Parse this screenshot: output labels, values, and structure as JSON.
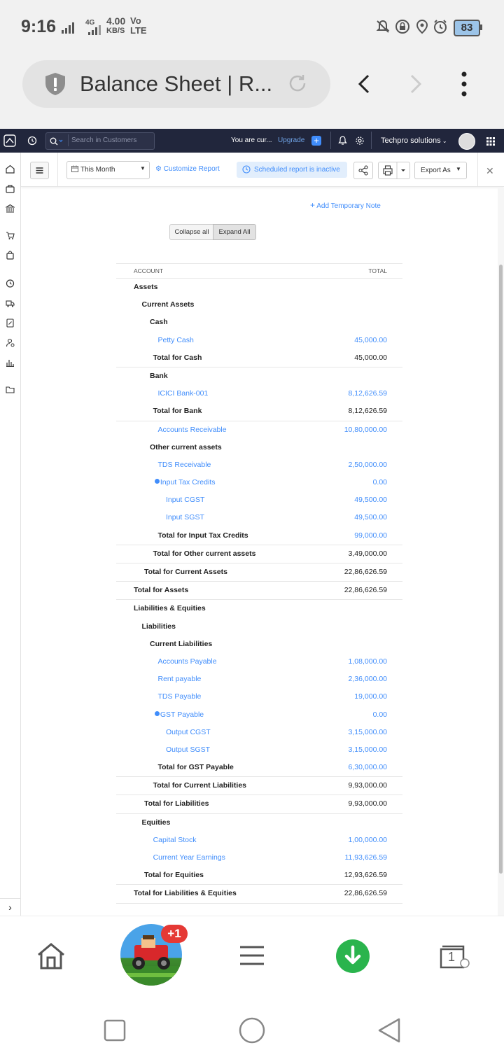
{
  "status_bar": {
    "time": "9:16",
    "net_top": "4.00",
    "net_bottom": "KB/S",
    "volte_top": "Vo",
    "volte_bottom": "LTE",
    "network_type": "4G",
    "battery": "83"
  },
  "browser": {
    "tab_title": "Balance Sheet | R...",
    "icons": [
      "shield-icon",
      "reload-icon",
      "back-icon",
      "forward-icon",
      "more-icon"
    ]
  },
  "app_nav": {
    "search_placeholder": "Search in Customers",
    "trial_text": "You are cur...",
    "upgrade_label": "Upgrade",
    "org_name": "Techpro solutions"
  },
  "toolbar": {
    "period": "This Month",
    "customize_label": "Customize Report",
    "scheduled_label": "Scheduled report is inactive",
    "export_label": "Export As"
  },
  "report": {
    "add_note_label": "Add Temporary Note",
    "collapse_label": "Collapse all",
    "expand_label": "Expand All",
    "col_account": "ACCOUNT",
    "col_total": "TOTAL",
    "rows": [
      {
        "label": "Assets",
        "amount": "",
        "indent": 0,
        "style": "section"
      },
      {
        "label": "Current Assets",
        "amount": "",
        "indent": 1,
        "style": "section"
      },
      {
        "label": "Cash",
        "amount": "",
        "indent": 2,
        "style": "section"
      },
      {
        "label": "Petty Cash",
        "amount": "45,000.00",
        "indent": 3,
        "style": "link"
      },
      {
        "label": "Total for Cash",
        "amount": "45,000.00",
        "indent": 2.4,
        "style": "total"
      },
      {
        "label": "Bank",
        "amount": "",
        "indent": 2,
        "style": "section"
      },
      {
        "label": "ICICI Bank-001",
        "amount": "8,12,626.59",
        "indent": 3,
        "style": "link"
      },
      {
        "label": "Total for Bank",
        "amount": "8,12,626.59",
        "indent": 2.4,
        "style": "total"
      },
      {
        "label": "Accounts Receivable",
        "amount": "10,80,000.00",
        "indent": 3,
        "style": "link"
      },
      {
        "label": "Other current assets",
        "amount": "",
        "indent": 2,
        "style": "section"
      },
      {
        "label": "TDS Receivable",
        "amount": "2,50,000.00",
        "indent": 3,
        "style": "link"
      },
      {
        "label": "Input Tax Credits",
        "amount": "0.00",
        "indent": 2.6,
        "style": "link-collapsible"
      },
      {
        "label": "Input CGST",
        "amount": "49,500.00",
        "indent": 4,
        "style": "link"
      },
      {
        "label": "Input SGST",
        "amount": "49,500.00",
        "indent": 4,
        "style": "link"
      },
      {
        "label": "Total for Input Tax Credits",
        "amount": "99,000.00",
        "indent": 3,
        "style": "total-link"
      },
      {
        "label": "Total for Other current assets",
        "amount": "3,49,000.00",
        "indent": 2.4,
        "style": "total"
      },
      {
        "label": "Total for Current Assets",
        "amount": "22,86,626.59",
        "indent": 1.3,
        "style": "total"
      },
      {
        "label": "Total for Assets",
        "amount": "22,86,626.59",
        "indent": 0,
        "style": "total"
      },
      {
        "label": "Liabilities & Equities",
        "amount": "",
        "indent": 0,
        "style": "section"
      },
      {
        "label": "Liabilities",
        "amount": "",
        "indent": 1,
        "style": "section"
      },
      {
        "label": "Current Liabilities",
        "amount": "",
        "indent": 2,
        "style": "section"
      },
      {
        "label": "Accounts Payable",
        "amount": "1,08,000.00",
        "indent": 3,
        "style": "link"
      },
      {
        "label": "Rent payable",
        "amount": "2,36,000.00",
        "indent": 3,
        "style": "link"
      },
      {
        "label": "TDS Payable",
        "amount": "19,000.00",
        "indent": 3,
        "style": "link"
      },
      {
        "label": "GST Payable",
        "amount": "0.00",
        "indent": 2.6,
        "style": "link-collapsible"
      },
      {
        "label": "Output CGST",
        "amount": "3,15,000.00",
        "indent": 4,
        "style": "link"
      },
      {
        "label": "Output SGST",
        "amount": "3,15,000.00",
        "indent": 4,
        "style": "link"
      },
      {
        "label": "Total for GST Payable",
        "amount": "6,30,000.00",
        "indent": 3,
        "style": "total-link"
      },
      {
        "label": "Total for Current Liabilities",
        "amount": "9,93,000.00",
        "indent": 2.4,
        "style": "total"
      },
      {
        "label": "Total for Liabilities",
        "amount": "9,93,000.00",
        "indent": 1.3,
        "style": "total"
      },
      {
        "label": "Equities",
        "amount": "",
        "indent": 1,
        "style": "section"
      },
      {
        "label": "Capital Stock",
        "amount": "1,00,000.00",
        "indent": 2.4,
        "style": "link"
      },
      {
        "label": "Current Year Earnings",
        "amount": "11,93,626.59",
        "indent": 2.4,
        "style": "link"
      },
      {
        "label": "Total for Equities",
        "amount": "12,93,626.59",
        "indent": 1.3,
        "style": "total"
      },
      {
        "label": "Total for Liabilities & Equities",
        "amount": "22,86,626.59",
        "indent": 0,
        "style": "total"
      }
    ]
  },
  "bottom_nav": {
    "badge": "+1",
    "tabs_count": "1",
    "icons": [
      "home-icon",
      "game-thumbnail",
      "menu-icon",
      "download-icon",
      "tabs-icon"
    ]
  },
  "colors": {
    "nav_bg": "#21263c",
    "accent": "#408dfb",
    "download_green": "#2ab44d",
    "badge_red": "#e53935"
  }
}
